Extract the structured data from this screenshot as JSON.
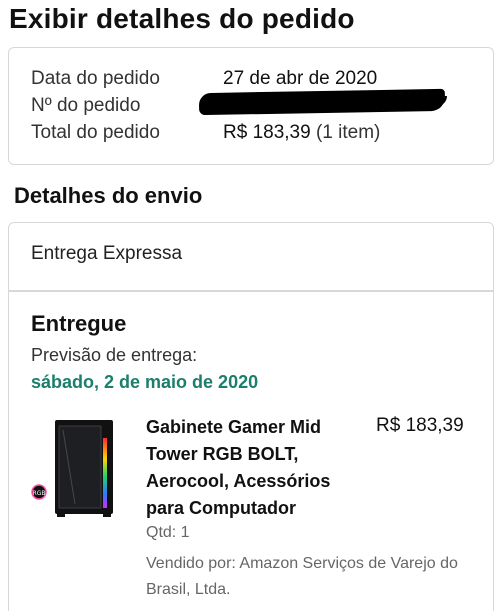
{
  "page": {
    "title": "Exibir detalhes do pedido"
  },
  "summary": {
    "order_date_label": "Data do pedido",
    "order_date_value": "27 de abr de 2020",
    "order_number_label": "Nº do pedido",
    "order_total_label": "Total do pedido",
    "order_total_value": "R$ 183,39",
    "order_total_items": "(1 item)"
  },
  "shipping": {
    "section_title": "Detalhes do envio",
    "method": "Entrega Expressa",
    "status": "Entregue",
    "eta_label": "Previsão de entrega:",
    "eta_date": "sábado, 2 de maio de 2020",
    "eta_color": "#1b7f6b"
  },
  "product": {
    "title": "Gabinete Gamer Mid Tower RGB BOLT, Aerocool, Acessórios para Computador",
    "price": "R$ 183,39",
    "qty": "Qtd: 1",
    "seller": "Vendido por: Amazon Serviços de Varejo do Brasil, Ltda.",
    "image_icon": "pc-case-icon"
  }
}
